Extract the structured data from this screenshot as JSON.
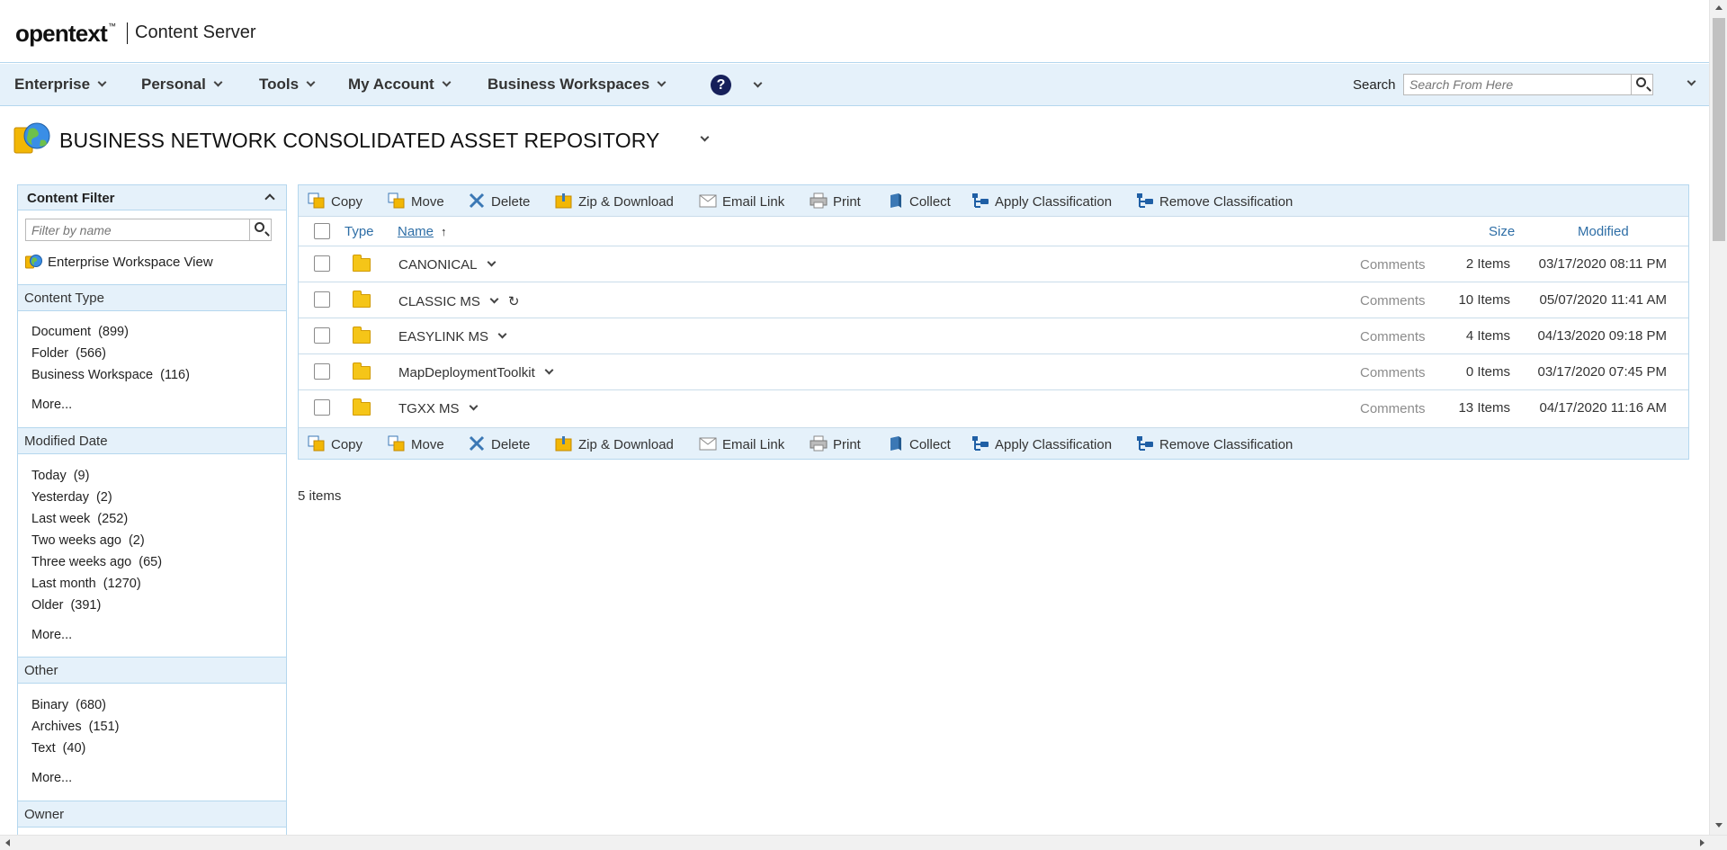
{
  "brand": {
    "logo": "opentext",
    "tm": "™",
    "product": "Content Server"
  },
  "nav": {
    "items": [
      "Enterprise",
      "Personal",
      "Tools",
      "My Account",
      "Business Workspaces"
    ],
    "help_icon": "?",
    "search_label": "Search",
    "search_placeholder": "Search From Here"
  },
  "page": {
    "title": "BUSINESS NETWORK CONSOLIDATED ASSET REPOSITORY"
  },
  "sidebar": {
    "title": "Content Filter",
    "filter_placeholder": "Filter by name",
    "workspace_view": "Enterprise Workspace View",
    "sections": [
      {
        "name": "Content Type",
        "items": [
          [
            "Document",
            "(899)"
          ],
          [
            "Folder",
            "(566)"
          ],
          [
            "Business Workspace",
            "(116)"
          ]
        ],
        "more": "More..."
      },
      {
        "name": "Modified Date",
        "items": [
          [
            "Today",
            "(9)"
          ],
          [
            "Yesterday",
            "(2)"
          ],
          [
            "Last week",
            "(252)"
          ],
          [
            "Two weeks ago",
            "(2)"
          ],
          [
            "Three weeks ago",
            "(65)"
          ],
          [
            "Last month",
            "(1270)"
          ],
          [
            "Older",
            "(391)"
          ]
        ],
        "more": "More..."
      },
      {
        "name": "Other",
        "items": [
          [
            "Binary",
            "(680)"
          ],
          [
            "Archives",
            "(151)"
          ],
          [
            "Text",
            "(40)"
          ]
        ],
        "more": "More..."
      },
      {
        "name": "Owner",
        "items": [],
        "more": ""
      }
    ]
  },
  "toolbar": {
    "buttons": [
      {
        "label": "Copy",
        "icon": "copy-icon"
      },
      {
        "label": "Move",
        "icon": "move-icon"
      },
      {
        "label": "Delete",
        "icon": "delete-icon"
      },
      {
        "label": "Zip & Download",
        "icon": "zip-download-icon"
      },
      {
        "label": "Email Link",
        "icon": "email-link-icon"
      },
      {
        "label": "Print",
        "icon": "print-icon"
      },
      {
        "label": "Collect",
        "icon": "collect-icon"
      },
      {
        "label": "Apply Classification",
        "icon": "apply-classification-icon"
      },
      {
        "label": "Remove Classification",
        "icon": "remove-classification-icon"
      }
    ]
  },
  "table": {
    "columns": {
      "type": "Type",
      "name": "Name",
      "size": "Size",
      "modified": "Modified"
    },
    "sort_indicator": "↑",
    "rows": [
      {
        "name": "CANONICAL",
        "comments": "Comments",
        "size": "2 Items",
        "modified": "03/17/2020 08:11 PM",
        "reload": false
      },
      {
        "name": "CLASSIC MS",
        "comments": "Comments",
        "size": "10 Items",
        "modified": "05/07/2020 11:41 AM",
        "reload": true
      },
      {
        "name": "EASYLINK MS",
        "comments": "Comments",
        "size": "4 Items",
        "modified": "04/13/2020 09:18 PM",
        "reload": false
      },
      {
        "name": "MapDeploymentToolkit",
        "comments": "Comments",
        "size": "0 Items",
        "modified": "03/17/2020 07:45 PM",
        "reload": false
      },
      {
        "name": "TGXX MS",
        "comments": "Comments",
        "size": "13 Items",
        "modified": "04/17/2020 11:16 AM",
        "reload": false
      }
    ],
    "item_count": "5 items"
  },
  "colors": {
    "accent_bg": "#e5f1fa",
    "border": "#b5d7ee",
    "link": "#2e6ea6",
    "folder": "#f5c518"
  }
}
